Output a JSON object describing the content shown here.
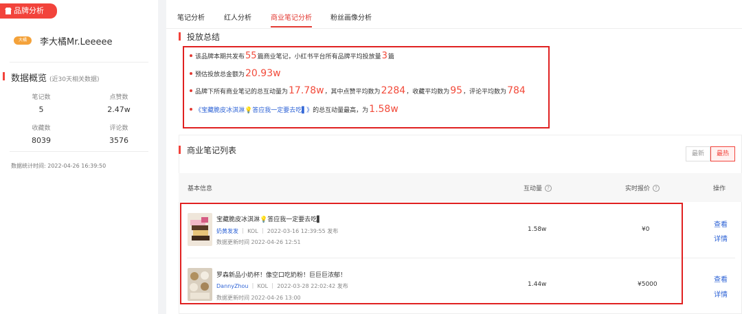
{
  "sidebar": {
    "brand_tag": "品牌分析",
    "brand_logo_text": "大橘",
    "brand_name": "李大橘Mr.Leeeee",
    "overview_title": "数据概览",
    "overview_note": "(近30天相关数据)",
    "stats": [
      {
        "label": "笔记数",
        "value": "5"
      },
      {
        "label": "点赞数",
        "value": "2.47w"
      },
      {
        "label": "收藏数",
        "value": "8039"
      },
      {
        "label": "评论数",
        "value": "3576"
      }
    ],
    "stat_time": "数据统计时间: 2022-04-26 16:39:50"
  },
  "tabs": [
    {
      "label": "笔记分析",
      "active": false
    },
    {
      "label": "红人分析",
      "active": false
    },
    {
      "label": "商业笔记分析",
      "active": true
    },
    {
      "label": "粉丝画像分析",
      "active": false
    }
  ],
  "summary": {
    "title": "投放总结",
    "line1": {
      "a": "该品牌本期共发布",
      "n1": "55",
      "b": "篇商业笔记，小红书平台所有品牌平均投放量",
      "n2": "3",
      "c": "篇"
    },
    "line2": {
      "a": "预估投放总金额为",
      "n1": "20.93w"
    },
    "line3": {
      "a": "品牌下所有商业笔记的总互动量为",
      "n1": "17.78w",
      "b": "，其中点赞平均数为",
      "n2": "2284",
      "c": "，收藏平均数为",
      "n3": "95",
      "d": "，评论平均数为",
      "n4": "784"
    },
    "line4": {
      "link": "《宝藏脆皮冰淇淋💡答应我一定要去吃▌》",
      "b": "的总互动量最高，为",
      "n1": "1.58w"
    }
  },
  "list": {
    "title": "商业笔记列表",
    "sort_options": [
      "最新",
      "最热"
    ],
    "sort_active": "最热",
    "columns": {
      "basic": "基本信息",
      "interaction": "互动量",
      "price": "实时报价",
      "ops": "操作"
    },
    "rows": [
      {
        "title": "宝藏脆皮冰淇淋💡答应我一定要去吃▌",
        "author": "奶黄发发",
        "meta": "｜ KOL ｜ 2022-03-16 12:39:55 发布",
        "updated": "数据更新时间 2022-04-26 12:51",
        "interaction": "1.58w",
        "price": "¥0",
        "op1": "查看",
        "op2": "详情"
      },
      {
        "title": "罗森新品小奶杯！像空口吃奶粉！巨巨巨浓郁！",
        "author": "DannyZhou",
        "meta": "｜ KOL ｜ 2022-03-28 22:02:42 发布",
        "updated": "数据更新时间 2022-04-26 13:00",
        "interaction": "1.44w",
        "price": "¥5000",
        "op1": "查看",
        "op2": "详情"
      }
    ]
  },
  "colors": {
    "accent": "#f2433b",
    "highlight_number": "#f24a3a",
    "link": "#2f64d6",
    "annotation_box": "#e02020"
  }
}
